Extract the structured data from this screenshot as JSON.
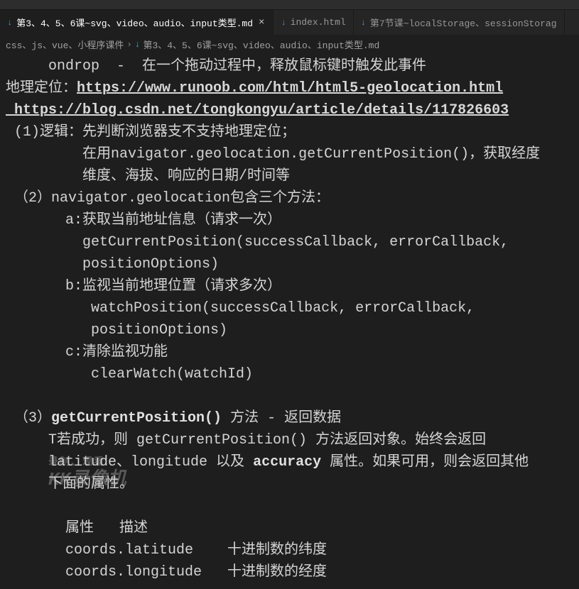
{
  "tabs": [
    {
      "label": "第3、4、5、6课~svg、video、audio、input类型.md",
      "active": true,
      "close": "×"
    },
    {
      "label": "index.html",
      "active": false
    },
    {
      "label": "第7节课~localStorage、sessionStorag",
      "active": false
    }
  ],
  "breadcrumb": {
    "segment1": "css、js、vue、小程序课件",
    "segment2": "第3、4、5、6课~svg、video、audio、input类型.md"
  },
  "content": {
    "l1_a": "     ondrop  -  ",
    "l1_b": "在一个拖动过程中，释放鼠标键时触发此事件",
    "l2_a": "地理定位：",
    "l2_link1": "https://www.runoob.com/html/html5-geolocation.html",
    "l3_link2": " https://blog.csdn.net/tongkongyu/article/details/117826603",
    "l4": " (1)逻辑：先判断浏览器支不支持地理定位；",
    "l5_a": "         在用",
    "l5_b": "navigator.geolocation.getCurrentPosition()",
    "l5_c": "，获取经度",
    "l6": "         维度、海拔、响应的日期/时间等",
    "l7_a": " （2）",
    "l7_b": "navigator.geolocation",
    "l7_c": "包含三个方法：",
    "l8": "       a:获取当前地址信息（请求一次）",
    "l9": "         getCurrentPosition(successCallback, errorCallback,",
    "l10": "         positionOptions)",
    "l11": "       b:监视当前地理位置（请求多次）",
    "l12": "          watchPosition(successCallback, errorCallback,",
    "l13": "          positionOptions)",
    "l14": "       c:清除监视功能",
    "l15": "          clearWatch(watchId)",
    "l16": " ",
    "l17_a": " （3）",
    "l17_b": "getCurrentPosition()",
    "l17_c": " 方法 - 返回数据",
    "l18_a": "     T若成功，则 ",
    "l18_b": "getCurrentPosition()",
    "l18_c": " 方法返回对象。始终会返回",
    "l19_a": "     latitude、longitude",
    "l19_b": " 以及 ",
    "l19_c": "accuracy",
    "l19_d": " 属性。如果可用，则会返回其他",
    "l20": "     下面的属性。",
    "l21": " ",
    "l22": "       属性   描述",
    "l23": "       coords.latitude    十进制数的纬度",
    "l24": "       coords.longitude   十进制数的经度"
  },
  "watermark": {
    "small": "录制、观看",
    "main": "KK录像机"
  }
}
